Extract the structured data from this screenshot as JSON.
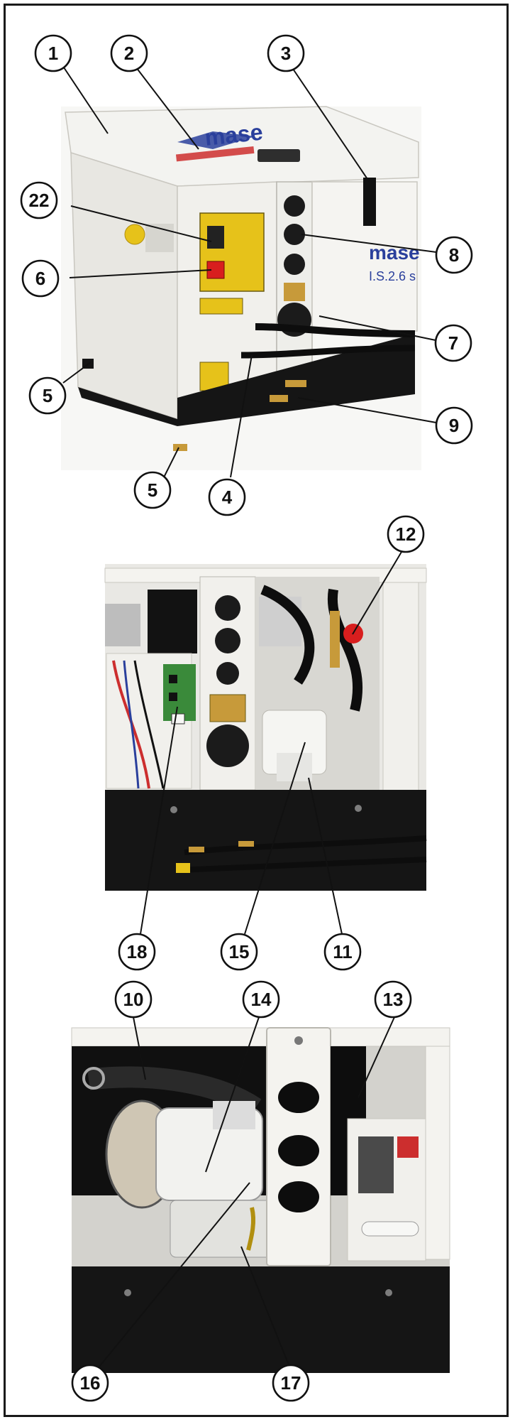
{
  "colors": {
    "panel_white": "#f1f0ec",
    "panel_shadow": "#cfcdc6",
    "base_black": "#151515",
    "hose_black": "#0d0d0d",
    "warning_yellow": "#e6c21a",
    "switch_red": "#d81e1e",
    "brass": "#c79a3a",
    "circuit_green": "#3a8a3a",
    "brand_blue": "#2a3f9c",
    "brand_red": "#cc2e2e"
  },
  "figure_1": {
    "brand_lid": "mase",
    "brand_side": "mase",
    "model": "I.S.2.6 s",
    "callouts": [
      "1",
      "2",
      "3",
      "22",
      "6",
      "5",
      "8",
      "7",
      "9",
      "5",
      "4"
    ]
  },
  "figure_2": {
    "callouts": [
      "12",
      "18",
      "15",
      "11"
    ]
  },
  "figure_3": {
    "callouts": [
      "10",
      "14",
      "13",
      "16",
      "17"
    ]
  }
}
